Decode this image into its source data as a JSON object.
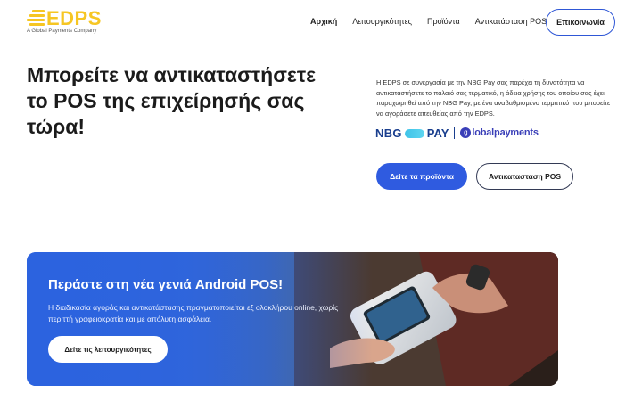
{
  "brand": {
    "logo_text": "EDPS",
    "tagline": "A Global Payments Company",
    "accent_color": "#f6c623"
  },
  "nav": {
    "items": [
      {
        "label": "Αρχική",
        "active": true
      },
      {
        "label": "Λειτουργικότητες",
        "active": false
      },
      {
        "label": "Προϊόντα",
        "active": false
      },
      {
        "label": "Αντικατάσταση POS",
        "active": false
      }
    ],
    "contact_label": "Επικοινωνία"
  },
  "hero": {
    "title": "Μπορείτε να αντικαταστήσετε το POS της επιχείρησής σας τώρα!",
    "description": "Η EDPS σε συνεργασία με την NBG Pay σας παρέχει τη δυνατότητα να αντικαταστήσετε το παλαιό σας τερματικό, η άδεια χρήσης του οποίου σας έχει παραχωρηθεί από την NBG Pay, με ένα αναβαθμισμένο τερματικό που μπορείτε να αγοράσετε απευθείας από την EDPS.",
    "partner_nbg": "NBG",
    "partner_pay": "PAY",
    "partner_gp": "lobalpayments",
    "partner_gp_mark": "g",
    "primary_button": "Δείτε τα προϊόντα",
    "secondary_button": "Αντικατασταση POS"
  },
  "banner": {
    "title": "Περάστε στη νέα γενιά Android POS!",
    "text": "Η διαδικασία αγοράς και αντικατάστασης πραγματοποιείται εξ ολοκλήρου online, χωρίς περιττή γραφειοκρατία και με απόλυτη ασφάλεια.",
    "button": "Δείτε τις λειτουργικότητες",
    "primary_color": "#2f5be0"
  }
}
